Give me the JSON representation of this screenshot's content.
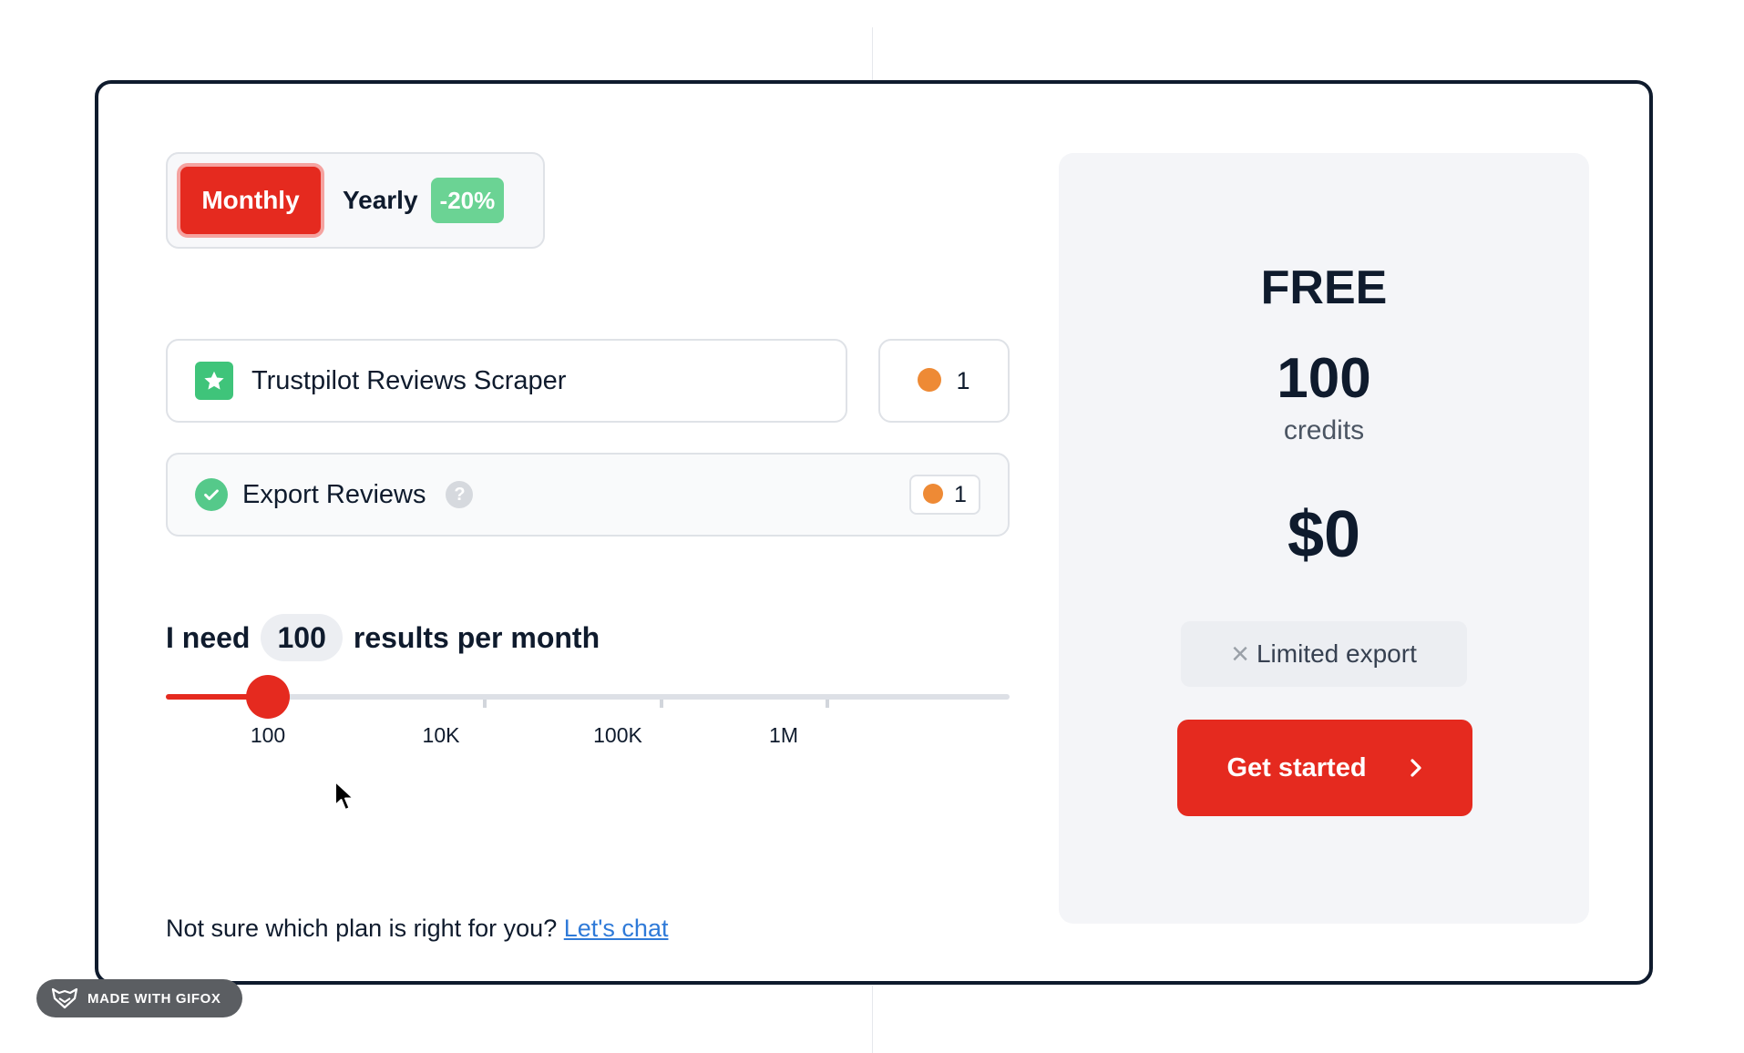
{
  "billing": {
    "monthly_label": "Monthly",
    "yearly_label": "Yearly",
    "yearly_discount": "-20%",
    "selected": "Monthly"
  },
  "actor": {
    "name": "Trustpilot Reviews Scraper",
    "icon": "star-icon",
    "credits": "1"
  },
  "addon": {
    "name": "Export Reviews",
    "icon": "check-circle-icon",
    "help_icon_text": "?",
    "credits": "1"
  },
  "results": {
    "prefix": "I need",
    "value": "100",
    "suffix": "results per month"
  },
  "slider": {
    "ticks": [
      "100",
      "10K",
      "100K",
      "1M"
    ],
    "selected": "100"
  },
  "help": {
    "text": "Not sure which plan is right for you?",
    "link": "Let's chat"
  },
  "plan": {
    "name": "FREE",
    "credits": "100",
    "credits_unit": "credits",
    "price": "$0",
    "feature_icon": "x-icon",
    "feature": "Limited export",
    "cta": "Get started",
    "cta_icon": "chevron-right-icon"
  },
  "watermark": {
    "text": "MADE WITH GIFOX"
  },
  "colors": {
    "accent": "#e52a1f",
    "discount": "#6bd394",
    "success": "#55c98a",
    "coin": "#ee8a35",
    "link": "#2f7ad8",
    "border": "#0f1b2d"
  }
}
